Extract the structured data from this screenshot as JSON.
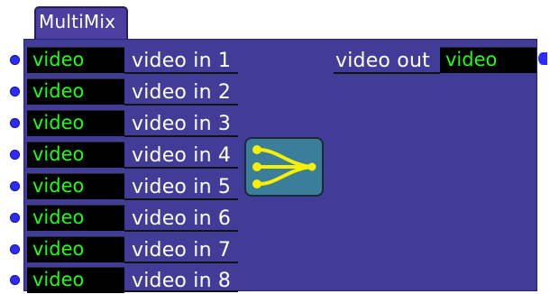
{
  "module": {
    "title": "MultiMix"
  },
  "inputs": [
    {
      "type": "video",
      "label": "video in 1"
    },
    {
      "type": "video",
      "label": "video in 2"
    },
    {
      "type": "video",
      "label": "video in 3"
    },
    {
      "type": "video",
      "label": "video in 4"
    },
    {
      "type": "video",
      "label": "video in 5"
    },
    {
      "type": "video",
      "label": "video in 6"
    },
    {
      "type": "video",
      "label": "video in 7"
    },
    {
      "type": "video",
      "label": "video in 8"
    }
  ],
  "output": {
    "label": "video out",
    "type": "video"
  },
  "icon": "mix-merge-icon",
  "colors": {
    "module_body": "#403c97",
    "type_text": "#1cff12",
    "port_dot": "#2c2cff",
    "icon_bg": "#3b7e99",
    "icon_lines": "#f7f000"
  }
}
